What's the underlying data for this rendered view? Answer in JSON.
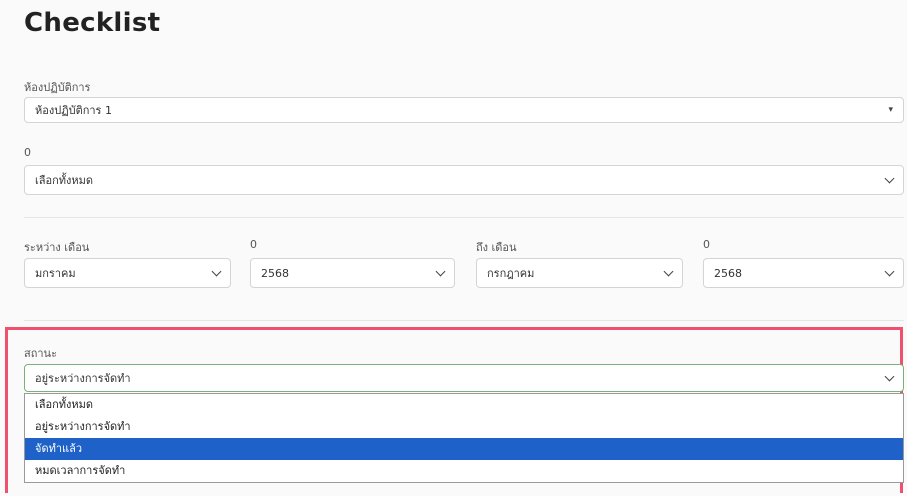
{
  "page": {
    "title": "Checklist"
  },
  "lab": {
    "label": "ห้องปฏิบัติการ",
    "value": "ห้องปฏิบัติการ 1"
  },
  "field2": {
    "label": "0",
    "value": "เลือกทั้งหมด"
  },
  "period": {
    "from_month_label": "ระหว่าง เดือน",
    "from_month_value": "มกราคม",
    "from_year_label": "0",
    "from_year_value": "2568",
    "to_month_label": "ถึง เดือน",
    "to_month_value": "กรกฎาคม",
    "to_year_label": "0",
    "to_year_value": "2568"
  },
  "status": {
    "label": "สถานะ",
    "value": "อยู่ระหว่างการจัดทำ",
    "options": [
      "เลือกทั้งหมด",
      "อยู่ระหว่างการจัดทำ",
      "จัดทำแล้ว",
      "หมดเวลาการจัดทำ"
    ],
    "highlighted_option": "จัดทำแล้ว"
  },
  "colors": {
    "highlight_border": "#f0506e",
    "option_selected": "#1e61c8",
    "focus_border": "#7cb07c"
  }
}
